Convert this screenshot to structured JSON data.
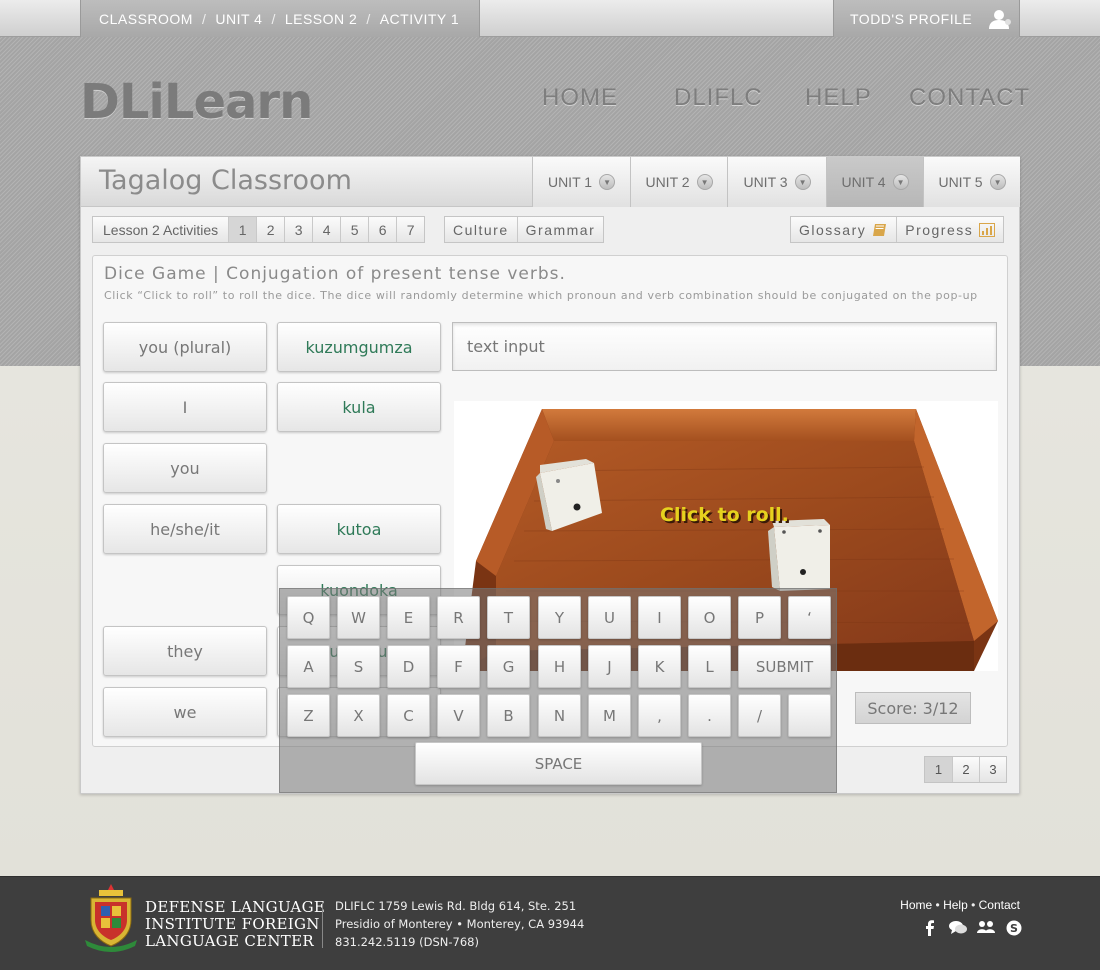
{
  "topbar": {
    "breadcrumb": [
      "CLASSROOM",
      "UNIT 4",
      "LESSON 2",
      "ACTIVITY 1"
    ],
    "breadcrumb_separator": "/",
    "profile_label": "TODD'S PROFILE",
    "profile_icon": "user-icon"
  },
  "logo": "DLiLearn",
  "nav": [
    "HOME",
    "DLIFLC",
    "HELP",
    "CONTACT"
  ],
  "classroom": {
    "title": "Tagalog Classroom",
    "units": [
      {
        "label": "UNIT 1",
        "active": false
      },
      {
        "label": "UNIT 2",
        "active": false
      },
      {
        "label": "UNIT 3",
        "active": false
      },
      {
        "label": "UNIT 4",
        "active": true
      },
      {
        "label": "UNIT 5",
        "active": false
      }
    ]
  },
  "activities_bar": {
    "lesson_label": "Lesson 2  Activities",
    "numbers": [
      "1",
      "2",
      "3",
      "4",
      "5",
      "6",
      "7"
    ],
    "selected": "1",
    "culture": "Culture",
    "grammar": "Grammar",
    "glossary": "Glossary",
    "progress": "Progress",
    "glossary_icon": "book-icon",
    "progress_icon": "bar-chart-icon"
  },
  "activity": {
    "title": "Dice Game | Conjugation of present tense verbs.",
    "description": "Click “Click to roll” to roll the dice. The dice will randomly determine which pronoun and verb combination should be conjugated on the pop-up",
    "pronouns": [
      "you (plural)",
      "I",
      "you",
      "he/she/it",
      "they",
      "we"
    ],
    "verbs": [
      "kuzumgumza",
      "kula",
      "kutoa",
      "kuondoka",
      "kuchukua"
    ],
    "text_input_value": "text input",
    "dice_caption": "Click to roll.",
    "score": "Score: 3/12"
  },
  "pager": {
    "pages": [
      "1",
      "2",
      "3"
    ],
    "selected": "1"
  },
  "keyboard": {
    "row1": [
      "Q",
      "W",
      "E",
      "R",
      "T",
      "Y",
      "U",
      "I",
      "O",
      "P",
      "‘"
    ],
    "row2": [
      "A",
      "S",
      "D",
      "F",
      "G",
      "H",
      "J",
      "K",
      "L"
    ],
    "submit": "SUBMIT",
    "row3": [
      "Z",
      "X",
      "C",
      "V",
      "B",
      "N",
      "M",
      ",",
      ".",
      "/",
      ""
    ],
    "space": "SPACE"
  },
  "footer": {
    "institute": [
      "DEFENSE LANGUAGE",
      "INSTITUTE FOREIGN",
      "LANGUAGE CENTER"
    ],
    "address": [
      "DLIFLC 1759 Lewis Rd. Bldg 614, Ste. 251",
      "Presidio of Monterey • Monterey, CA 93944",
      "831.242.5119 (DSN-768)"
    ],
    "links": [
      "Home",
      "Help",
      "Contact"
    ],
    "link_separator": "•",
    "social_icons": [
      "facebook-icon",
      "chat-icon",
      "group-icon",
      "skype-icon"
    ]
  },
  "colors": {
    "verb_text": "#2f7a58",
    "dice_caption": "#e6d21e",
    "footer_bg": "#3e3e3e"
  }
}
